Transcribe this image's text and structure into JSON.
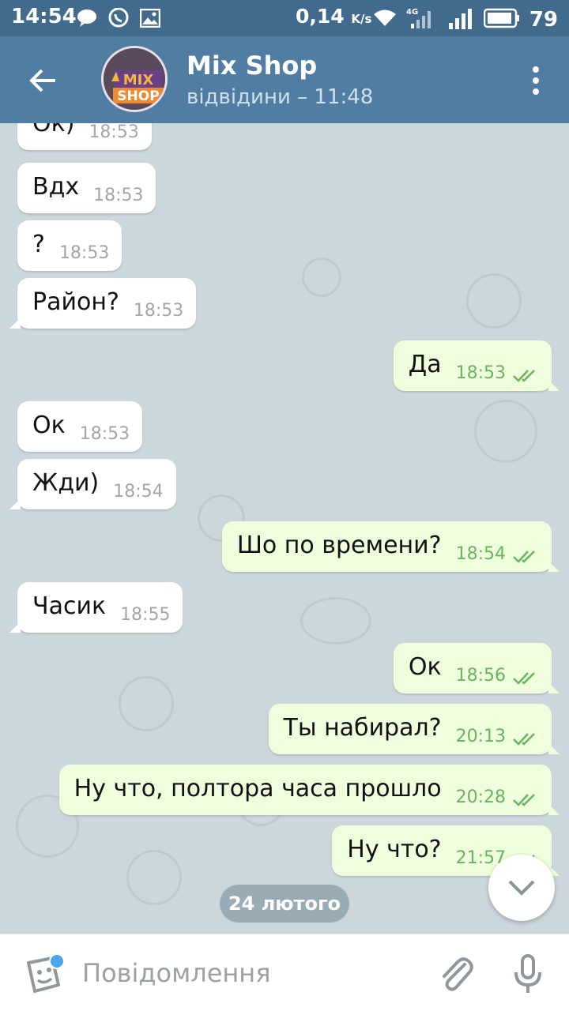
{
  "status_bar": {
    "time": "14:54",
    "speed_value": "0,14",
    "speed_unit": "K/s",
    "network": "4G",
    "battery": "79"
  },
  "header": {
    "title": "Mix Shop",
    "status": "відвідини – 11:48",
    "avatar_text_top": "MIX",
    "avatar_text_bottom": "SHOP"
  },
  "messages": [
    {
      "dir": "in",
      "text": "Ок)",
      "time": "18:53"
    },
    {
      "dir": "in",
      "text": "Вдх",
      "time": "18:53"
    },
    {
      "dir": "in",
      "text": "?",
      "time": "18:53"
    },
    {
      "dir": "in",
      "text": "Район?",
      "time": "18:53"
    },
    {
      "dir": "out",
      "text": "Да",
      "time": "18:53"
    },
    {
      "dir": "in",
      "text": "Ок",
      "time": "18:53"
    },
    {
      "dir": "in",
      "text": "Жди)",
      "time": "18:54"
    },
    {
      "dir": "out",
      "text": "Шо по времени?",
      "time": "18:54"
    },
    {
      "dir": "in",
      "text": "Часик",
      "time": "18:55"
    },
    {
      "dir": "out",
      "text": "Ок",
      "time": "18:56"
    },
    {
      "dir": "out",
      "text": "Ты набирал?",
      "time": "20:13"
    },
    {
      "dir": "out",
      "text": "Ну что, полтора часа прошло",
      "time": "20:28"
    },
    {
      "dir": "out",
      "text": "Ну что?",
      "time": "21:57"
    }
  ],
  "date_separator": "24 лютого",
  "composer": {
    "placeholder": "Повідомлення"
  },
  "colors": {
    "header": "#517da2",
    "status_bar": "#426a8c",
    "outgoing_bubble": "#effedd",
    "incoming_bubble": "#ffffff",
    "read_ticks": "#6ab45f"
  }
}
